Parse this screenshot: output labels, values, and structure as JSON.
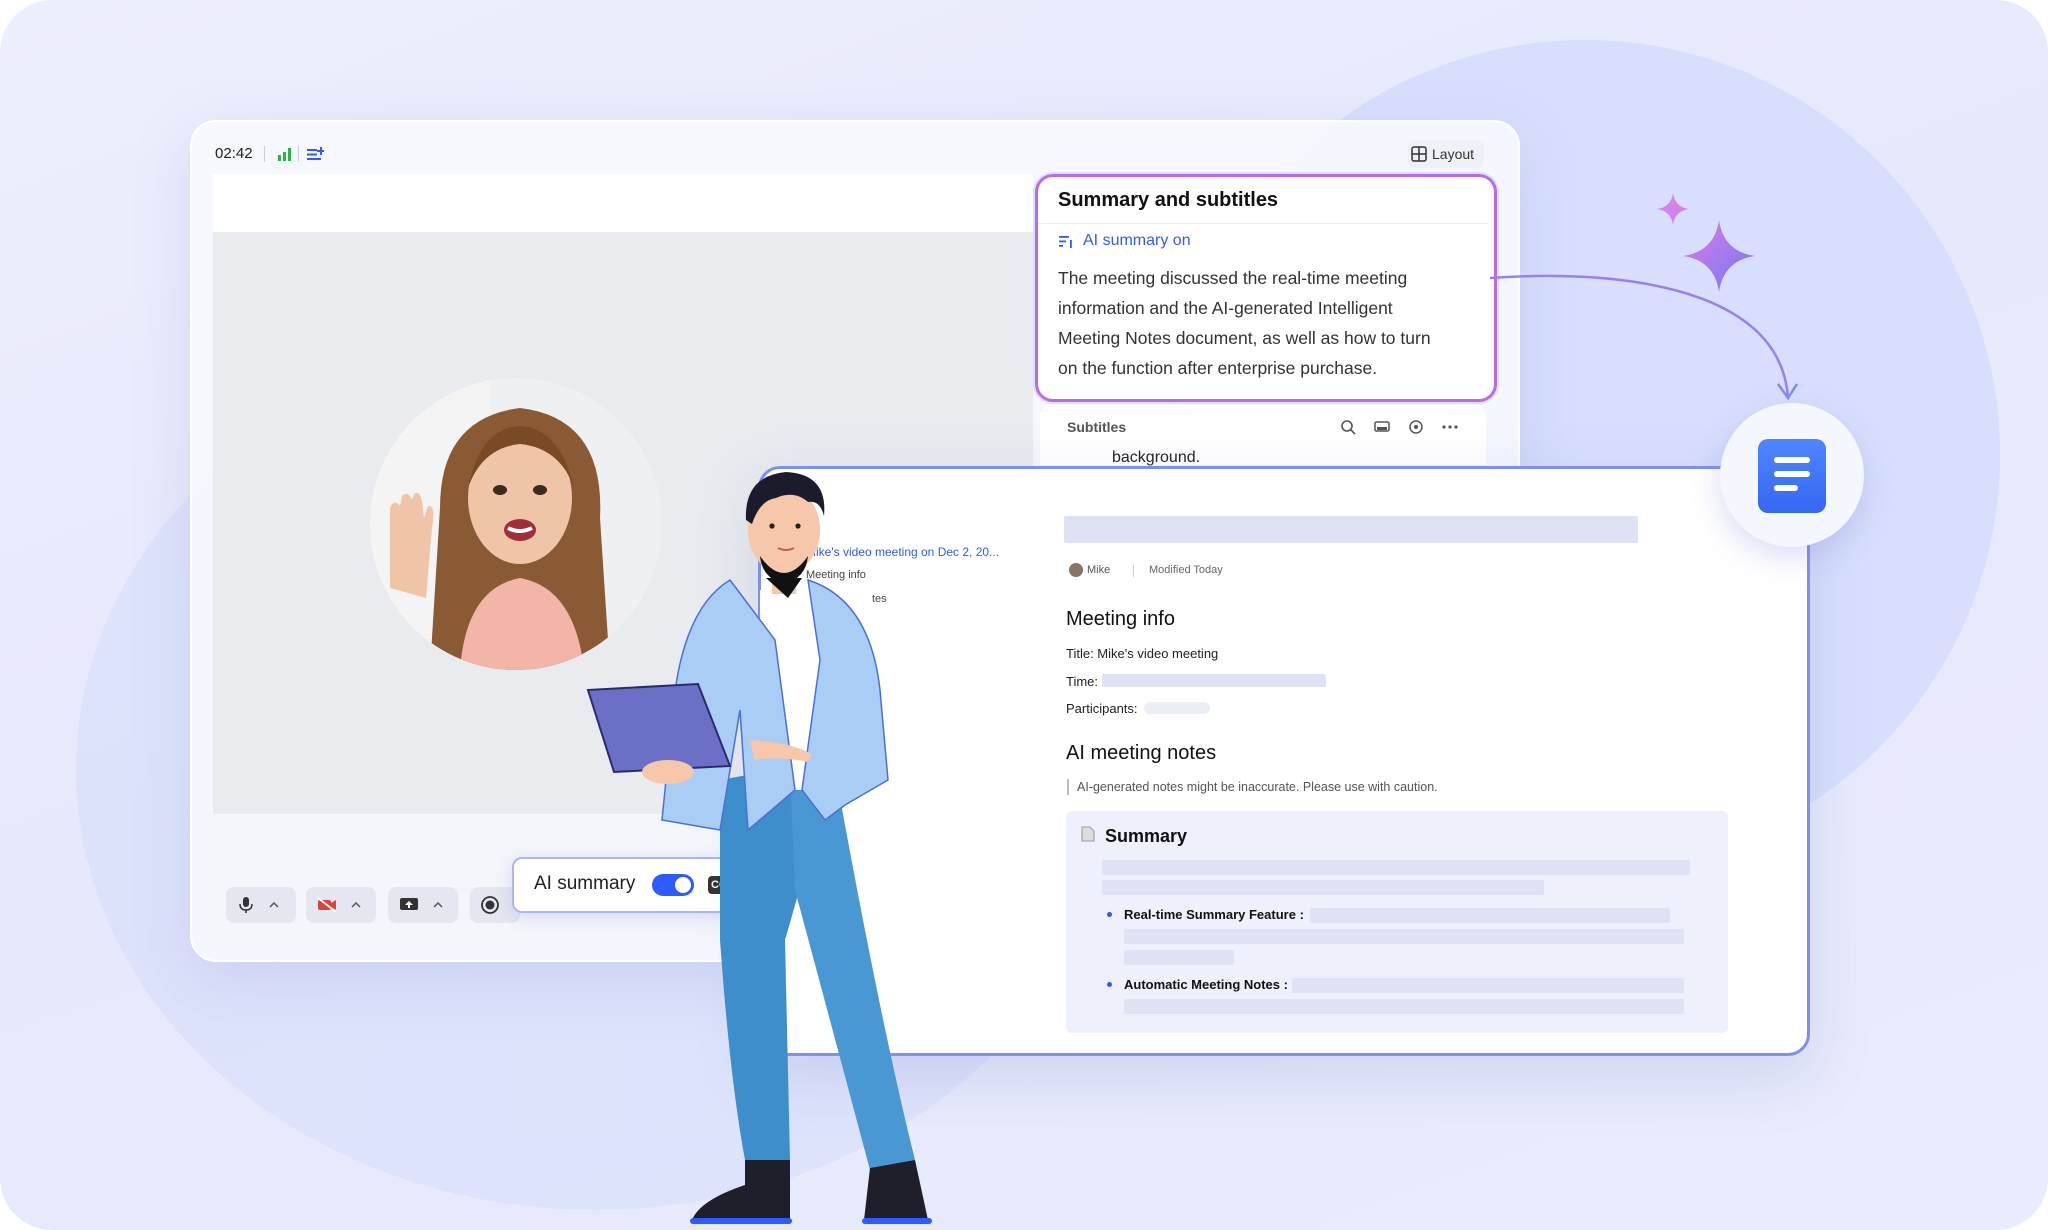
{
  "topbar": {
    "timer": "02:42",
    "layout_label": "Layout"
  },
  "summary_card": {
    "title": "Summary and subtitles",
    "status": "AI summary on",
    "text_lines": [
      "The meeting discussed the real-time meeting",
      "information and the AI-generated Intelligent",
      "Meeting Notes document, as well as how to turn",
      "on the function after enterprise purchase."
    ]
  },
  "subtitles": {
    "label": "Subtitles",
    "partial_text": "background."
  },
  "ai_toggle": {
    "label": "AI summary",
    "enabled": true,
    "cc_label": "CC"
  },
  "doc": {
    "toc": {
      "link": "Mike's video meeting on Dec 2, 20...",
      "item1": "Meeting info",
      "item2": "tes"
    },
    "author": "Mike",
    "modified": "Modified Today",
    "meeting_info_heading": "Meeting info",
    "title_line": "Title: Mike's video meeting",
    "time_label": "Time:",
    "participants_label": "Participants:",
    "ai_notes_heading": "AI meeting notes",
    "disclaimer": "AI-generated notes might be inaccurate. Please use with caution.",
    "summary_heading": "Summary",
    "bullet1": "Real-time Summary Feature :",
    "bullet2": "Automatic Meeting Notes :"
  },
  "colors": {
    "accent": "#2d5bff",
    "summary_border": "#c069e6",
    "signal_green": "#2fb344",
    "sparkle": "#a56cf0"
  },
  "icons": [
    "signal-bars-icon",
    "list-plus-icon",
    "layout-grid-icon",
    "sliders-icon",
    "search-icon",
    "screen-icon",
    "settings-icon",
    "more-icon",
    "mic-icon",
    "camera-off-icon",
    "share-screen-icon",
    "record-icon",
    "chevron-up-icon",
    "document-icon",
    "sparkle-icon"
  ]
}
